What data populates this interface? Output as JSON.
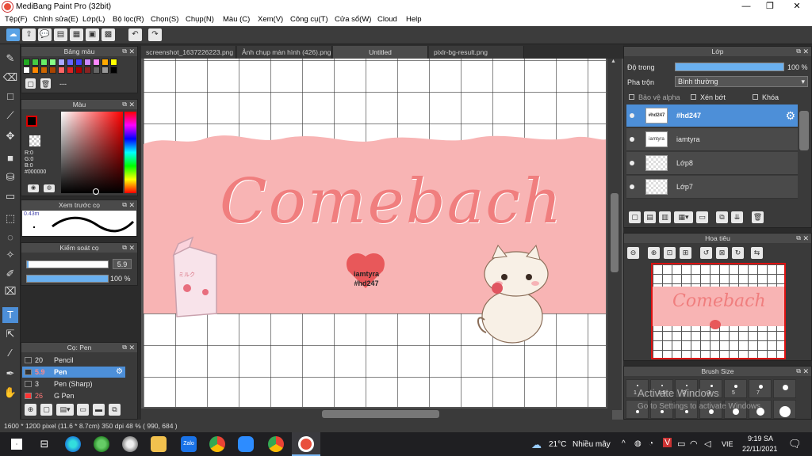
{
  "window": {
    "title": "MediBang Paint Pro (32bit)",
    "minimize": "—",
    "maximize": "❐",
    "close": "✕"
  },
  "menu": [
    "Tệp(F)",
    "Chỉnh sửa(E)",
    "Lớp(L)",
    "Bộ lọc(R)",
    "Chọn(S)",
    "Chụp(N)",
    "Màu (C)",
    "Xem(V)",
    "Công cụ(T)",
    "Cửa sổ(W)",
    "Cloud",
    "Help"
  ],
  "toolbar": {
    "undo": "↶",
    "redo": "↷"
  },
  "tabs": [
    "screenshot_1637226223.png",
    "Ảnh chụp màn hình (426).png",
    "Untitled",
    "pixlr-bg-result.png"
  ],
  "panels": {
    "palette": {
      "title": "Bảng màu",
      "dash": "---"
    },
    "color": {
      "title": "Màu",
      "r": "R:0",
      "g": "G:0",
      "b": "B:0",
      "hex": "#000000"
    },
    "preview": {
      "title": "Xem trước cọ",
      "size": "0.43m"
    },
    "control": {
      "title": "Kiểm soát cọ",
      "size": "5.9",
      "opacity": "100 %",
      "size_frac": 0.02,
      "opacity_frac": 1.0
    },
    "brushes": {
      "title": "Cọ: Pen",
      "items": [
        {
          "size": "20",
          "name": "Pencil",
          "color": "#333333"
        },
        {
          "size": "5.9",
          "name": "Pen",
          "color": "#333333"
        },
        {
          "size": "3",
          "name": "Pen (Sharp)",
          "color": "#333333"
        },
        {
          "size": "26",
          "name": "G Pen",
          "color": "#ff3333"
        }
      ]
    }
  },
  "layers": {
    "title": "Lớp",
    "opacity_label": "Độ trong",
    "opacity_value": "100 %",
    "opacity_frac": 1.0,
    "blend_label": "Pha trộn",
    "blend_value": "Bình thường",
    "protect_alpha": "Bảo vệ alpha",
    "clipping": "Xén bớt",
    "lock": "Khóa",
    "items": [
      {
        "name": "#hd247",
        "thumb": "#hd247"
      },
      {
        "name": "iamtyra",
        "thumb": "iamtyra"
      },
      {
        "name": "Lớp8",
        "thumb": ""
      },
      {
        "name": "Lớp7",
        "thumb": ""
      }
    ]
  },
  "navigator": {
    "title": "Hoa tiêu",
    "thumb_text": "Comebach"
  },
  "brushsize": {
    "title": "Brush Size",
    "labels": [
      "1",
      "1.5",
      "2",
      "3",
      "5",
      "7"
    ]
  },
  "canvas": {
    "headline": "Comebach",
    "heart_line1": "iamtyra",
    "heart_line2": "#hd247",
    "milk_label": "ミルク"
  },
  "status": {
    "text": "1600 * 1200 pixel  (11.6 * 8.7cm)  350 dpi  48 %  ( 990, 684 )"
  },
  "watermark": {
    "line1": "Activate Windows",
    "line2": "Go to Settings to activate Windows."
  },
  "taskbar": {
    "temperature": "21°C",
    "weather": "Nhiều mây",
    "lang": "VIE",
    "time": "9:19 SA",
    "date": "22/11/2021"
  },
  "colors": {
    "accent": "#4d8fd8",
    "pink": "#f8b4b4",
    "title_pink": "#f07e7e",
    "heart": "#e8585a"
  }
}
